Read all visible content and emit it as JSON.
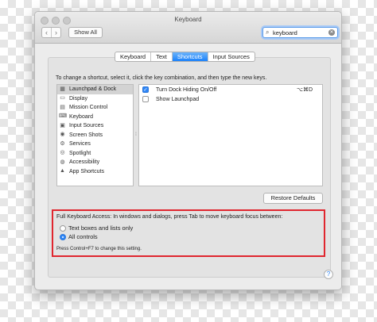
{
  "window": {
    "title": "Keyboard"
  },
  "toolbar": {
    "back_icon": "‹",
    "forward_icon": "›",
    "show_all_label": "Show All"
  },
  "search": {
    "value": "keyboard",
    "clear_icon": "✕",
    "icon": "search-icon"
  },
  "tabs": [
    {
      "label": "Keyboard",
      "active": false
    },
    {
      "label": "Text",
      "active": false
    },
    {
      "label": "Shortcuts",
      "active": true
    },
    {
      "label": "Input Sources",
      "active": false
    }
  ],
  "instructions": "To change a shortcut, select it, click the key combination, and then type the new keys.",
  "categories": [
    {
      "label": "Launchpad & Dock",
      "icon": "launchpad-icon",
      "selected": true
    },
    {
      "label": "Display",
      "icon": "display-icon",
      "selected": false
    },
    {
      "label": "Mission Control",
      "icon": "mission-control-icon",
      "selected": false
    },
    {
      "label": "Keyboard",
      "icon": "keyboard-icon",
      "selected": false
    },
    {
      "label": "Input Sources",
      "icon": "input-sources-icon",
      "selected": false
    },
    {
      "label": "Screen Shots",
      "icon": "screenshot-icon",
      "selected": false
    },
    {
      "label": "Services",
      "icon": "services-icon",
      "selected": false
    },
    {
      "label": "Spotlight",
      "icon": "spotlight-icon",
      "selected": false
    },
    {
      "label": "Accessibility",
      "icon": "accessibility-icon",
      "selected": false
    },
    {
      "label": "App Shortcuts",
      "icon": "app-shortcuts-icon",
      "selected": false
    }
  ],
  "shortcuts": [
    {
      "label": "Turn Dock Hiding On/Off",
      "checked": true,
      "key": "⌥⌘D"
    },
    {
      "label": "Show Launchpad",
      "checked": false,
      "key": ""
    }
  ],
  "restore_defaults_label": "Restore Defaults",
  "full_keyboard_access": {
    "title": "Full Keyboard Access: In windows and dialogs, press Tab to move keyboard focus between:",
    "options": [
      {
        "label": "Text boxes and lists only",
        "selected": false
      },
      {
        "label": "All controls",
        "selected": true
      }
    ],
    "note": "Press Control+F7 to change this setting."
  },
  "help_label": "?",
  "colors": {
    "accent": "#2f86f7",
    "highlight_border": "#e0262f"
  }
}
